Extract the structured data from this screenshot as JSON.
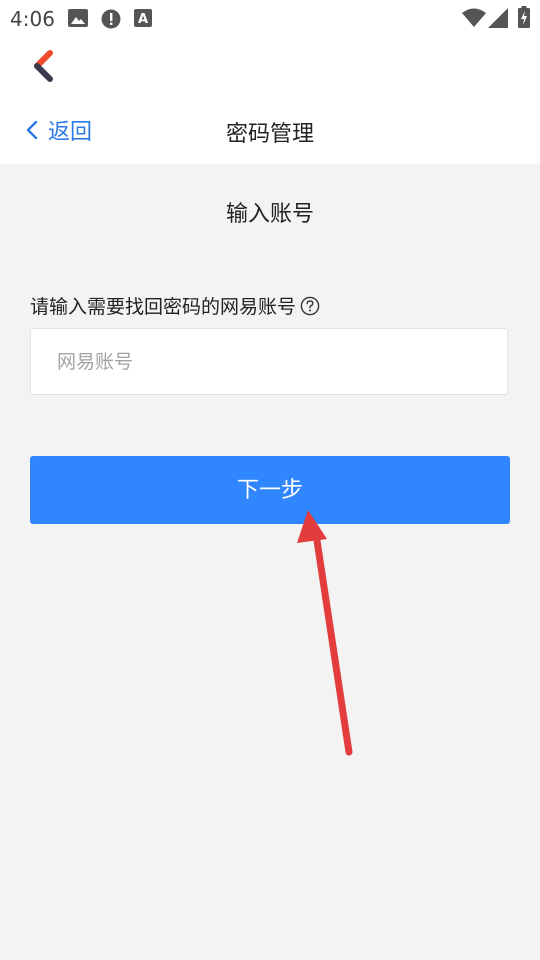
{
  "status_bar": {
    "time": "4:06",
    "icons": [
      "image-icon",
      "alert-icon",
      "font-icon",
      "wifi-icon",
      "signal-icon",
      "battery-charging-icon"
    ]
  },
  "app_bar": {
    "logo_icon": "chevron-logo-icon"
  },
  "nav": {
    "back_label": "返回",
    "title": "密码管理"
  },
  "form": {
    "step_title": "输入账号",
    "label": "请输入需要找回密码的网易账号",
    "help_icon": "question-circle-icon",
    "input_placeholder": "网易账号",
    "input_value": "",
    "next_label": "下一步"
  },
  "annotation": {
    "arrow_color": "#e23c3c"
  },
  "colors": {
    "accent": "#2f86ff",
    "link": "#2c7be5",
    "background": "#f3f3f3"
  }
}
